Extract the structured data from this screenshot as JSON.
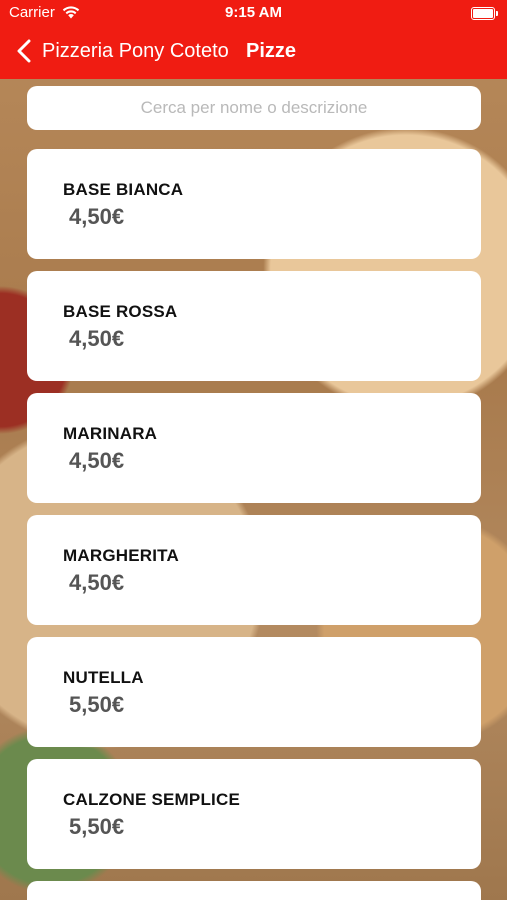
{
  "status": {
    "carrier": "Carrier",
    "time": "9:15 AM"
  },
  "nav": {
    "back_label": "Pizzeria Pony Coteto",
    "title": "Pizze"
  },
  "search": {
    "placeholder": "Cerca per nome o descrizione"
  },
  "items": [
    {
      "name": "BASE BIANCA",
      "price": "4,50€"
    },
    {
      "name": "BASE ROSSA",
      "price": "4,50€"
    },
    {
      "name": "MARINARA",
      "price": "4,50€"
    },
    {
      "name": "MARGHERITA",
      "price": "4,50€"
    },
    {
      "name": "NUTELLA",
      "price": "5,50€"
    },
    {
      "name": "CALZONE SEMPLICE",
      "price": "5,50€"
    }
  ],
  "theme": {
    "header_color": "#f01c12"
  }
}
